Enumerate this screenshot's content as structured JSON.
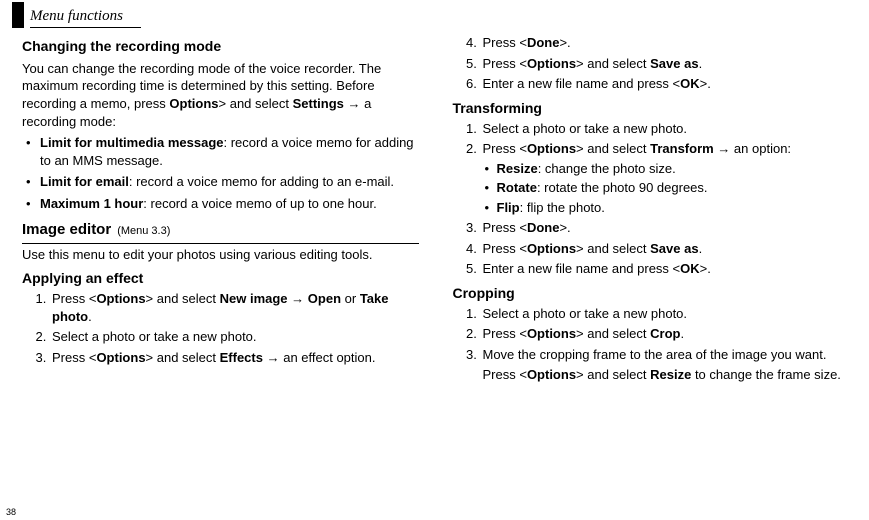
{
  "header": {
    "title": "Menu functions"
  },
  "page_number": "38",
  "left": {
    "section1": {
      "title": "Changing the recording mode",
      "intro": "You can change the recording mode of the voice recorder. The maximum recording time is determined by this setting. Before recording a memo, press <__B__>Options</__B__>> and select <__B__>Settings</__B__> → a recording mode:",
      "bullets": [
        "<__B__>Limit for multimedia message</__B__>: record a voice memo for adding to an MMS message.",
        "<__B__>Limit for email</__B__>: record a voice memo for adding to an e-mail.",
        "<__B__>Maximum 1 hour</__B__>: record a voice memo of up to one hour."
      ]
    },
    "section2": {
      "title": "Image editor",
      "menu_ref": "(Menu 3.3)",
      "intro": "Use this menu to edit your photos using various editing tools."
    },
    "section3": {
      "title": "Applying an effect",
      "steps": [
        "Press <<__B__>Options</__B__>> and select <__B__>New image</__B__> → <__B__>Open</__B__> or <__B__>Take photo</__B__>.",
        "Select a photo or take a new photo.",
        "Press <<__B__>Options</__B__>> and select <__B__>Effects</__B__> → an effect option."
      ]
    }
  },
  "right": {
    "steps_cont": [
      {
        "n": 4,
        "t": "Press <<__B__>Done</__B__>>."
      },
      {
        "n": 5,
        "t": "Press <<__B__>Options</__B__>> and select <__B__>Save as</__B__>."
      },
      {
        "n": 6,
        "t": "Enter a new file name and press <<__B__>OK</__B__>>."
      }
    ],
    "section1": {
      "title": "Transforming",
      "steps": [
        {
          "t": "Select a photo or take a new photo."
        },
        {
          "t": "Press <<__B__>Options</__B__>> and select <__B__>Transform</__B__> → an option:",
          "sub": [
            "<__B__>Resize</__B__>: change the photo size.",
            "<__B__>Rotate</__B__>: rotate the photo 90 degrees.",
            "<__B__>Flip</__B__>: flip the photo."
          ]
        },
        {
          "t": "Press <<__B__>Done</__B__>>."
        },
        {
          "t": "Press <<__B__>Options</__B__>> and select <__B__>Save as</__B__>."
        },
        {
          "t": "Enter a new file name and press <<__B__>OK</__B__>>."
        }
      ]
    },
    "section2": {
      "title": "Cropping",
      "steps": [
        {
          "t": "Select a photo or take a new photo."
        },
        {
          "t": "Press <<__B__>Options</__B__>> and select <__B__>Crop</__B__>."
        },
        {
          "t": "Move the cropping frame to the area of the image you want.",
          "extra": "Press <<__B__>Options</__B__>> and select <__B__>Resize</__B__> to change the frame size."
        }
      ]
    }
  }
}
